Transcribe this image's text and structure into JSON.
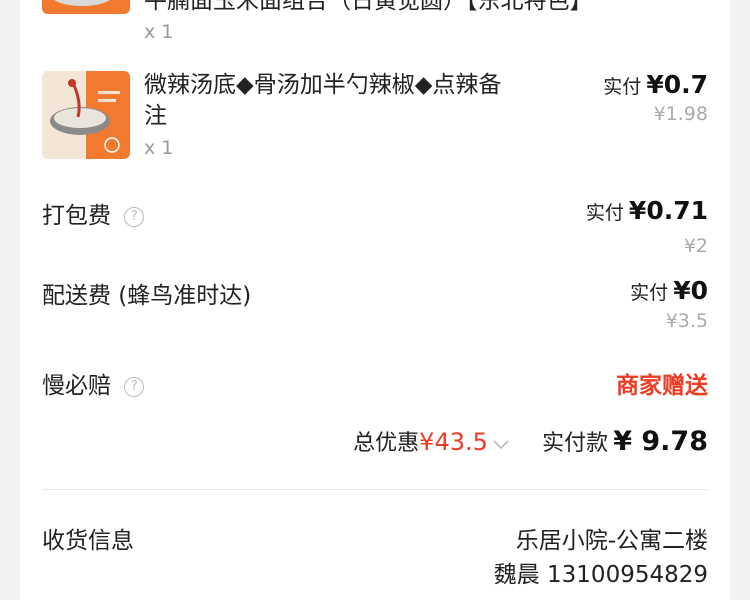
{
  "items": [
    {
      "title": "牛腩面玉米面组合（日黄觉圆）【东北特色】",
      "qty": "x 1"
    },
    {
      "title_line1": "微辣汤底◆骨汤加半勺辣椒◆点辣备",
      "title_line2": "注",
      "qty": "x 1",
      "paid_label": "实付",
      "paid_value": "¥0.7",
      "original_price": "¥1.98"
    }
  ],
  "packing_fee": {
    "label": "打包费",
    "paid_label": "实付",
    "paid_value": "¥0.71",
    "original": "¥2"
  },
  "delivery_fee": {
    "label": "配送费 (蜂鸟准时达)",
    "paid_label": "实付",
    "paid_value": "¥0",
    "original": "¥3.5"
  },
  "slow_compensation": {
    "label": "慢必赔",
    "value": "商家赠送"
  },
  "summary": {
    "discount_label": "总优惠",
    "discount_value": "¥43.5",
    "total_label": "实付款",
    "total_value": "¥ 9.78"
  },
  "receiver": {
    "label": "收货信息",
    "address": "乐居小院-公寓二楼",
    "name_phone": "魏晨 13100954829"
  },
  "colors": {
    "accent_red": "#ee3b24",
    "thumb_orange": "#f27a2e"
  },
  "icons": {
    "help": "question-circle-icon",
    "chevron": "chevron-down-icon"
  }
}
